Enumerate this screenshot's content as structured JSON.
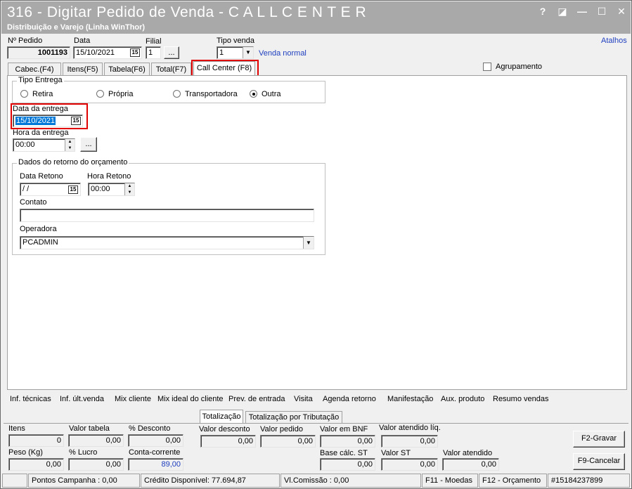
{
  "window": {
    "title": "316 - Digitar Pedido de Venda - C A L L   C E N T E R",
    "subtitle": "Distribuição e Varejo (Linha WinThor)",
    "controls": [
      "?",
      "◪",
      "—",
      "☐",
      "✕"
    ]
  },
  "header": {
    "pedido_label": "Nº Pedido",
    "pedido_value": "1001193",
    "data_label": "Data",
    "data_value": "15/10/2021",
    "filial_label": "Filial",
    "filial_value": "1",
    "ellipsis": "...",
    "tipo_venda_label": "Tipo venda",
    "tipo_venda_value": "1",
    "tipo_venda_desc": "Venda normal",
    "atalhos": "Atalhos"
  },
  "tabs": [
    "Cabec.(F4)",
    "Itens(F5)",
    "Tabela(F6)",
    "Total(F7)",
    "Call Center (F8)"
  ],
  "agrupamento_label": "Agrupamento",
  "tipo_entrega": {
    "title": "Tipo Entrega",
    "options": [
      "Retira",
      "Própria",
      "Transportadora",
      "Outra"
    ],
    "selected": "Outra"
  },
  "data_entrega": {
    "label": "Data da entrega",
    "value": "15/10/2021"
  },
  "hora_entrega": {
    "label": "Hora da entrega",
    "value": "00:00",
    "ellipsis": "..."
  },
  "retorno": {
    "title": "Dados do retorno do orçamento",
    "data_label": "Data Retono",
    "data_value": " /  /",
    "hora_label": "Hora Retono",
    "hora_value": "00:00",
    "contato_label": "Contato",
    "contato_value": "",
    "operadora_label": "Operadora",
    "operadora_value": "PCADMIN"
  },
  "links": [
    "Inf. técnicas",
    "Inf. últ.venda",
    "Mix cliente",
    "Mix ideal do cliente",
    "Prev. de entrada",
    "Visita",
    "Agenda retorno",
    "Manifestação",
    "Aux. produto",
    "Resumo vendas"
  ],
  "bottom_tabs": [
    "Totalização",
    "Totalização por Tributação"
  ],
  "totals": {
    "itens_label": "Itens",
    "itens_value": "0",
    "valor_tabela_label": "Valor tabela",
    "valor_tabela_value": "0,00",
    "pct_desconto_label": "% Desconto",
    "pct_desconto_value": "0,00",
    "valor_desconto_label": "Valor desconto",
    "valor_desconto_value": "0,00",
    "valor_pedido_label": "Valor pedido",
    "valor_pedido_value": "0,00",
    "valor_bnf_label": "Valor em BNF",
    "valor_bnf_value": "0,00",
    "valor_atendido_liq_label": "Valor atendido líq.",
    "valor_atendido_liq_value": "0,00",
    "peso_label": "Peso (Kg)",
    "peso_value": "0,00",
    "pct_lucro_label": "% Lucro",
    "pct_lucro_value": "0,00",
    "conta_corrente_label": "Conta-corrente",
    "conta_corrente_value": "89,00",
    "base_st_label": "Base cálc. ST",
    "base_st_value": "0,00",
    "valor_st_label": "Valor ST",
    "valor_st_value": "0,00",
    "valor_atendido_label": "Valor atendido",
    "valor_atendido_value": "0,00"
  },
  "buttons": {
    "gravar": "F2-Gravar",
    "cancelar": "F9-Cancelar"
  },
  "status": {
    "pontos": "Pontos Campanha : 0,00",
    "credito": "Crédito Disponível: 77.694,87",
    "comissao": "Vl.Comissão : 0,00",
    "f11": "F11 - Moedas",
    "f12": "F12 - Orçamento",
    "id": "#15184237899"
  },
  "colors": {
    "titlebar": "#a9a9a9",
    "highlight": "#0078d7",
    "link": "#1f3fbf",
    "annotation": "#e00000"
  }
}
